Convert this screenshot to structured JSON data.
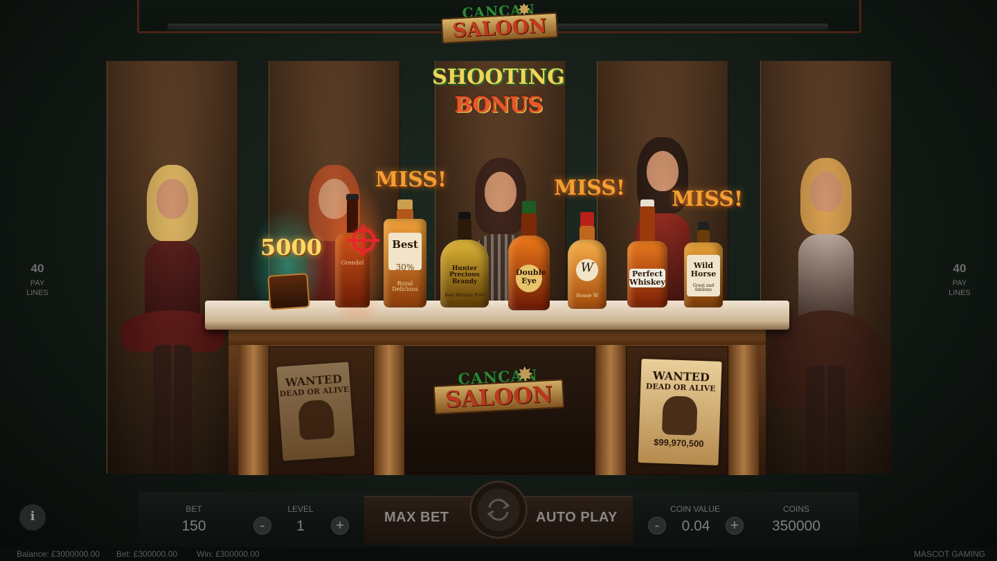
{
  "logo": {
    "cancan": "CANCAN",
    "saloon": "SALOON"
  },
  "bonus_title": {
    "line1": "SHOOTING",
    "line2": "BONUS"
  },
  "paylines": {
    "left_count": "40",
    "right_count": "40",
    "label_line1": "PAY",
    "label_line2": "LINES"
  },
  "prize_text": "5000",
  "miss_text": "MISS!",
  "bottles": [
    {
      "label": "Grendel"
    },
    {
      "label": "Best",
      "sub": "30%",
      "foot": "Royal Delicious"
    },
    {
      "label": "Hunter Precious Brandy",
      "foot": "Best Whiskey Ever"
    },
    {
      "label": "Double Eye"
    },
    {
      "label": "W",
      "foot": "House W"
    },
    {
      "label": "Perfect Whiskey"
    },
    {
      "label": "Wild Horse",
      "foot": "Great and fabilous"
    }
  ],
  "poster": {
    "title": "WANTED",
    "subtitle": "DEAD OR ALIVE",
    "amount": "$99,970,500"
  },
  "controls": {
    "bet_label": "BET",
    "bet_value": "150",
    "level_label": "LEVEL",
    "level_value": "1",
    "max_bet_label": "MAX BET",
    "auto_play_label": "AUTO PLAY",
    "coin_value_label": "COIN VALUE",
    "coin_value": "0.04",
    "coins_label": "COINS",
    "coins_value": "350000",
    "minus": "-",
    "plus": "+",
    "info": "i"
  },
  "status": {
    "balance": "Balance: £3000000.00",
    "bet": "Bet: £300000.00",
    "win": "Win: £300000.00",
    "brand": "MASCOT GAMING"
  },
  "colors": {
    "accent_gold": "#f3d35a",
    "miss_orange": "#f3a034",
    "target_red": "#e8262a",
    "bonus_red": "#e8562b"
  }
}
